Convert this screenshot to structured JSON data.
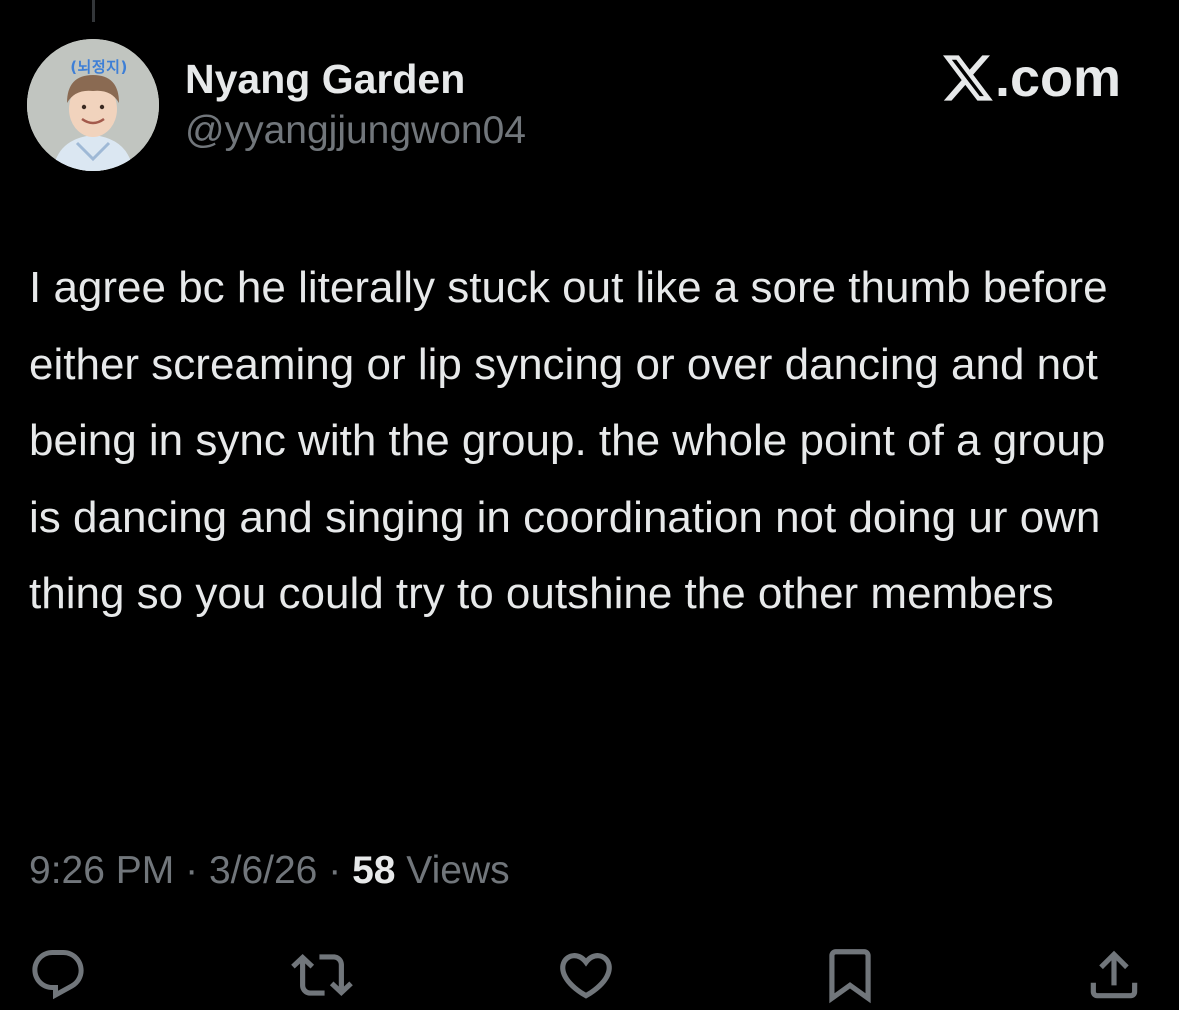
{
  "author": {
    "display_name": "Nyang Garden",
    "handle": "@yyangjjungwon04",
    "avatar_tag": "(뇌정지)"
  },
  "brand": {
    "label": ".com",
    "icon": "x-logo-icon"
  },
  "tweet": {
    "text": "I agree bc he literally stuck out like a sore thumb before either screaming or lip syncing or over dancing and not being in sync with the group. the whole point of a group is dancing and singing in coordination not doing ur own thing so you could try to outshine the other members"
  },
  "meta": {
    "time": "9:26 PM",
    "separator": "·",
    "date": "3/6/26",
    "views_count": "58",
    "views_label": "Views"
  },
  "actions": [
    {
      "name": "reply",
      "icon": "reply-icon"
    },
    {
      "name": "repost",
      "icon": "repost-icon"
    },
    {
      "name": "like",
      "icon": "heart-icon"
    },
    {
      "name": "bookmark",
      "icon": "bookmark-icon"
    },
    {
      "name": "share",
      "icon": "share-icon"
    }
  ],
  "colors": {
    "background": "#000000",
    "primary_text": "#e7e9ea",
    "secondary_text": "#71767b"
  }
}
